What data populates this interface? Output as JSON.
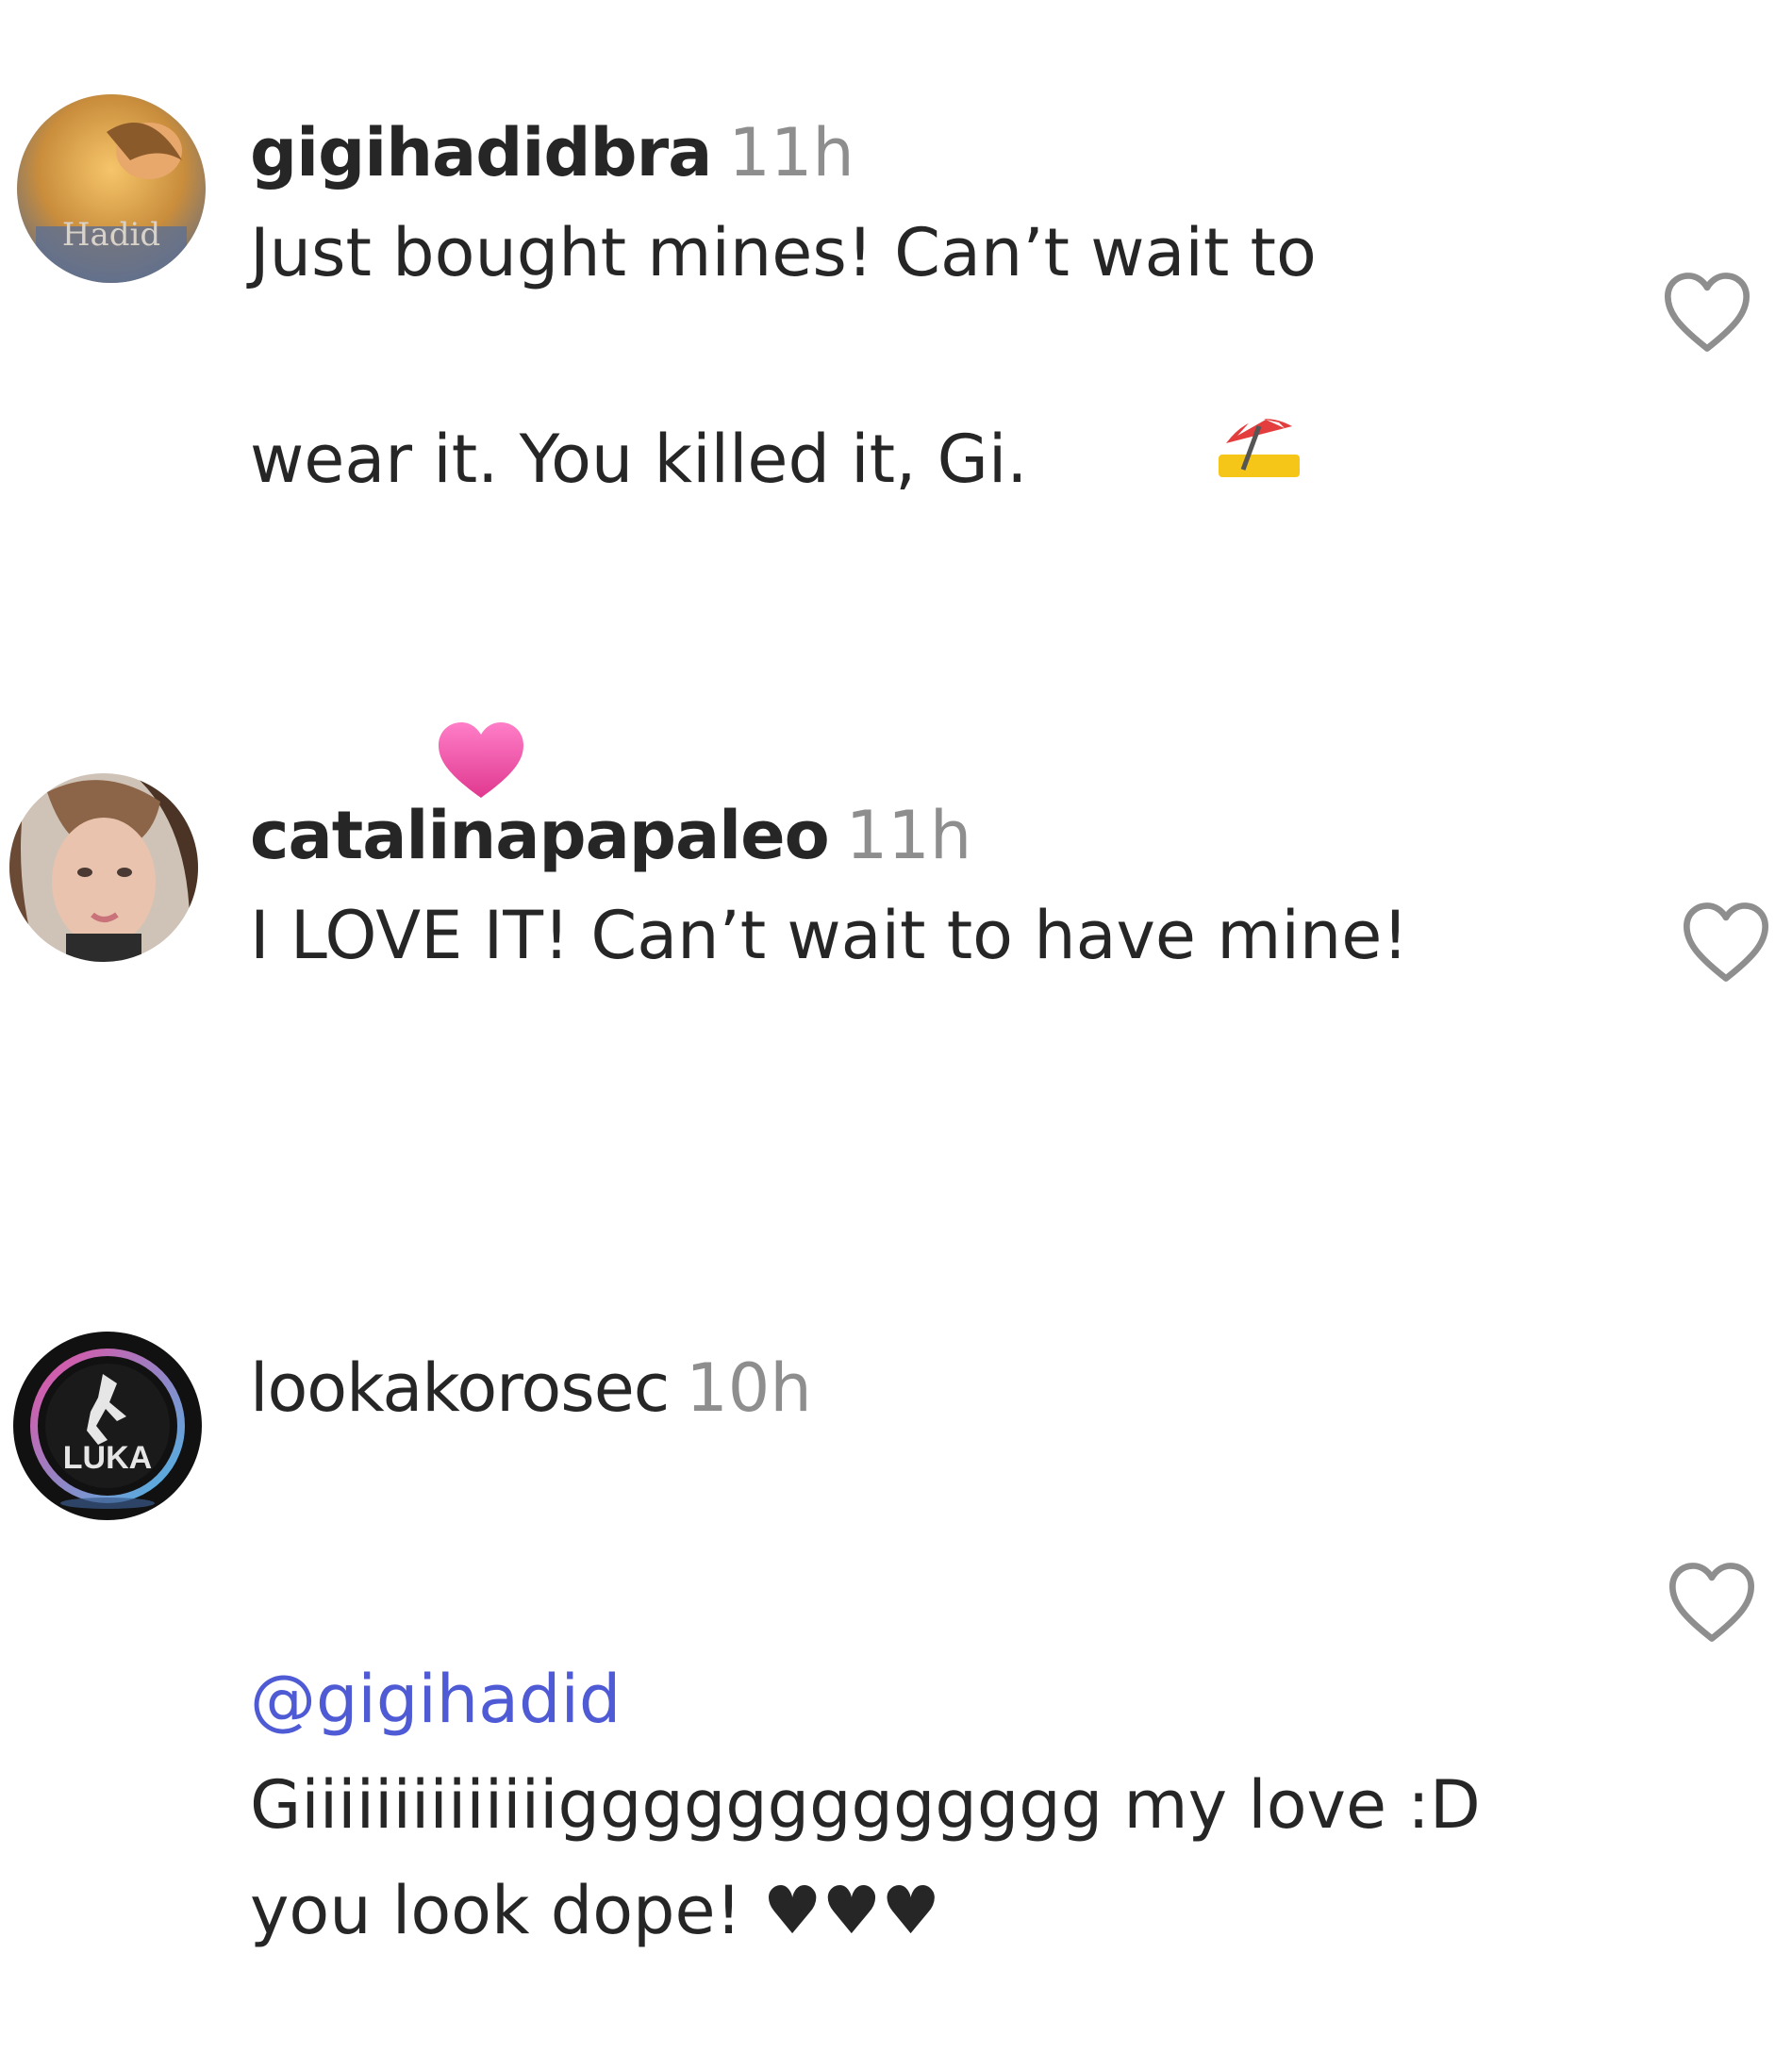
{
  "comments": [
    {
      "username": "gigihadidbra",
      "time": "11h",
      "text": "Just bought mines! Can’t wait to wear it. You killed it, Gi.",
      "emojis": [
        "umbrella-on-ground-emoji",
        "pink-heart-emoji"
      ],
      "avatar_text": "Hadid",
      "like_icon": "heart-outline-icon"
    },
    {
      "username": "catalinapapaleo",
      "time": "11h",
      "text": "I LOVE IT! Can’t wait to have mine!",
      "like_icon": "heart-outline-icon"
    },
    {
      "username": "lookakorosec",
      "time": "10h",
      "mention": "@gigihadid",
      "text": "Giiiiiiiiiiiiiiggggggggggggg my love :D you look dope! ♥♥♥",
      "avatar_text": "LUKA",
      "like_icon": "heart-outline-icon"
    }
  ],
  "colors": {
    "username": "#262626",
    "timestamp": "#8e8e8e",
    "mention": "#4f5bd5",
    "like_outline": "#8e8e8e"
  }
}
